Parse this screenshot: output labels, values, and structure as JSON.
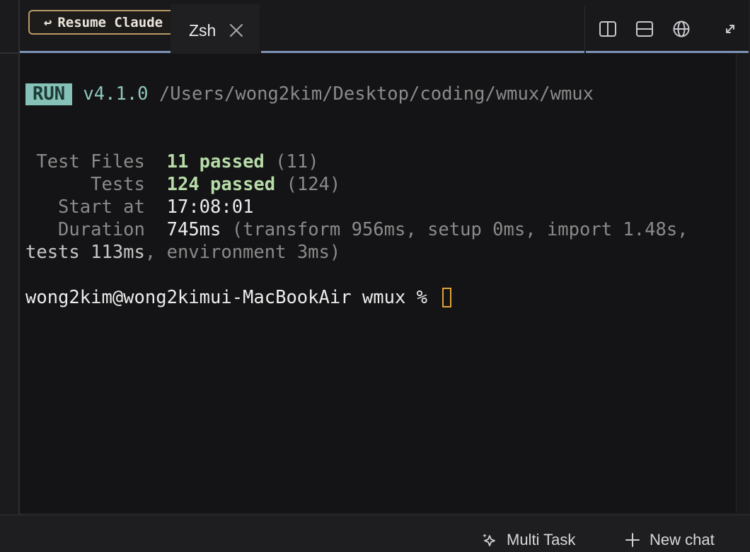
{
  "tabbar": {
    "resume_button": {
      "glyph": "↩",
      "label": "Resume Claude"
    },
    "active_tab": {
      "title": "Zsh"
    },
    "icons": [
      "split-vertical-icon",
      "split-horizontal-icon",
      "globe-icon",
      "expand-icon"
    ]
  },
  "terminal": {
    "run_badge": "RUN",
    "version": "v4.1.0",
    "path": "/Users/wong2kim/Desktop/coding/wmux/wmux",
    "summary": {
      "test_files": {
        "label": " Test Files",
        "value": "11 passed",
        "extra": " (11)"
      },
      "tests": {
        "label": "      Tests",
        "value": "124 passed",
        "extra": " (124)"
      },
      "start_at": {
        "label": "   Start at",
        "value": "17:08:01"
      },
      "duration": {
        "label": "   Duration",
        "value": "745ms",
        "detail_line1": " (transform 956ms, setup 0ms, import 1.48s,",
        "detail_line2_a": "tests 113ms",
        "detail_line2_b": ", environment 3ms)"
      }
    },
    "prompt": "wong2kim@wong2kimui-MacBookAir wmux % "
  },
  "bottom_bar": {
    "multi_task_label": "Multi Task",
    "new_chat_label": "New chat"
  },
  "colors": {
    "accent_underline": "#7d93b5",
    "resume_border": "#b89a62",
    "run_badge_bg": "#85c1b7",
    "pass_green": "#b7dca8",
    "cursor_orange": "#e0a238"
  }
}
